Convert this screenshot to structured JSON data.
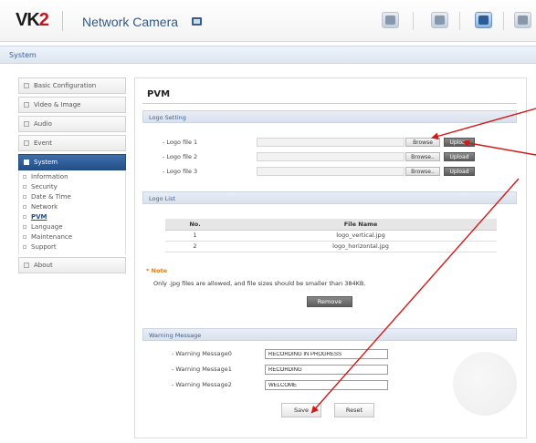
{
  "header": {
    "logo": "VK2",
    "title": "Network Camera"
  },
  "breadcrumb": "System",
  "sidebar": {
    "items": [
      {
        "label": "Basic Configuration"
      },
      {
        "label": "Video & Image"
      },
      {
        "label": "Audio"
      },
      {
        "label": "Event"
      },
      {
        "label": "System"
      }
    ],
    "system_sub": [
      {
        "label": "Information"
      },
      {
        "label": "Security"
      },
      {
        "label": "Date & Time"
      },
      {
        "label": "Network"
      },
      {
        "label": "PVM"
      },
      {
        "label": "Language"
      },
      {
        "label": "Maintenance"
      },
      {
        "label": "Support"
      }
    ],
    "about": "About"
  },
  "main": {
    "title": "PVM",
    "logo_setting": {
      "header": "Logo Setting",
      "files": [
        {
          "label": "- Logo file 1",
          "browse": "Browse",
          "upload": "Upload"
        },
        {
          "label": "- Logo file 2",
          "browse": "Browse..",
          "upload": "Upload"
        },
        {
          "label": "- Logo file 3",
          "browse": "Browse..",
          "upload": "Upload"
        }
      ]
    },
    "logo_list": {
      "header": "Logo List",
      "columns": [
        "No.",
        "File Name"
      ],
      "rows": [
        [
          "1",
          "logo_vertical.jpg"
        ],
        [
          "2",
          "logo_horizontal.jpg"
        ]
      ]
    },
    "note": {
      "title": "* Note",
      "text": "Only .jpg files are allowed, and file sizes should be smaller than 384KB."
    },
    "remove_label": "Remove",
    "warning": {
      "header": "Warning Message",
      "messages": [
        {
          "label": "- Warning Message0",
          "value": "RECORDING IN PROGRESS"
        },
        {
          "label": "- Warning Message1",
          "value": "RECORDING"
        },
        {
          "label": "- Warning Message2",
          "value": "WELCOME"
        }
      ]
    },
    "save_label": "Save",
    "reset_label": "Reset"
  },
  "colors": {
    "accent": "#24508a",
    "logo_red": "#c3161c",
    "note": "#e07b16",
    "arrow": "#d11a1a"
  }
}
